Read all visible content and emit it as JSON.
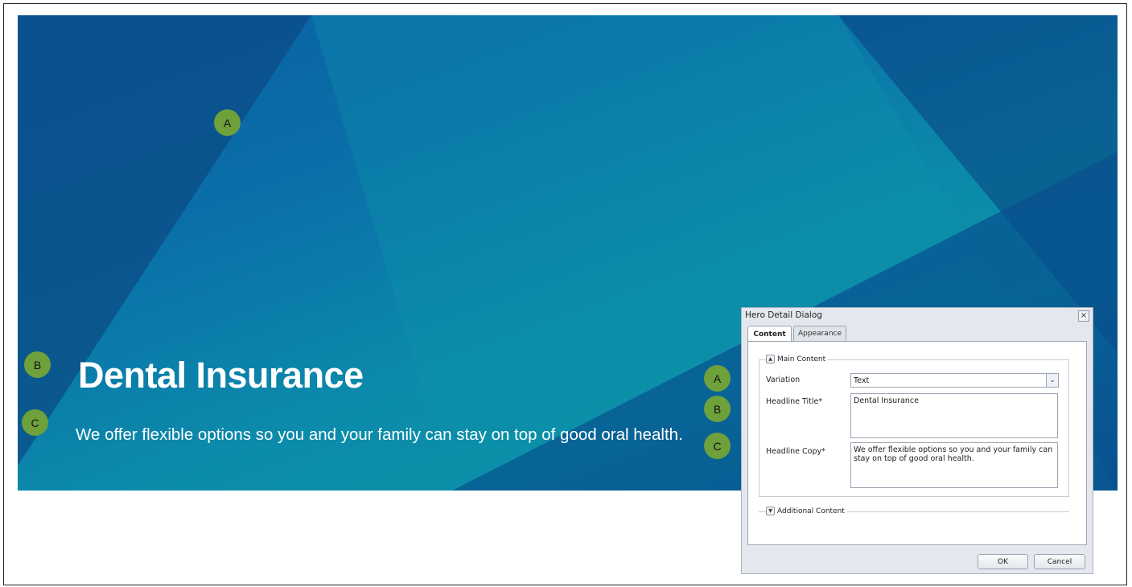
{
  "hero": {
    "title": "Dental Insurance",
    "copy": "We offer flexible options so you and your family can stay on top of good oral health.",
    "markers": {
      "a": "A",
      "b": "B",
      "c": "C"
    }
  },
  "dialog": {
    "title": "Hero Detail Dialog",
    "close_glyph": "×",
    "tabs": [
      "Content",
      "Appearance"
    ],
    "main_section": "Main Content",
    "fields": {
      "variation_label": "Variation",
      "variation_value": "Text",
      "headline_title_label": "Headline Title*",
      "headline_title_value": "Dental Insurance",
      "headline_copy_label": "Headline Copy*",
      "headline_copy_value": "We offer flexible options so you and your family can stay on top of good oral health."
    },
    "additional_section": "Additional Content",
    "buttons": {
      "ok": "OK",
      "cancel": "Cancel"
    },
    "markers": {
      "a": "A",
      "b": "B",
      "c": "C"
    }
  },
  "icons": {
    "expand": "▲",
    "collapse": "▼",
    "dropdown": "chevron-down-icon"
  },
  "colors": {
    "hero_primary": "#0a5fa3",
    "hero_teal": "#0c8cab",
    "marker_green": "#6ea03c"
  }
}
